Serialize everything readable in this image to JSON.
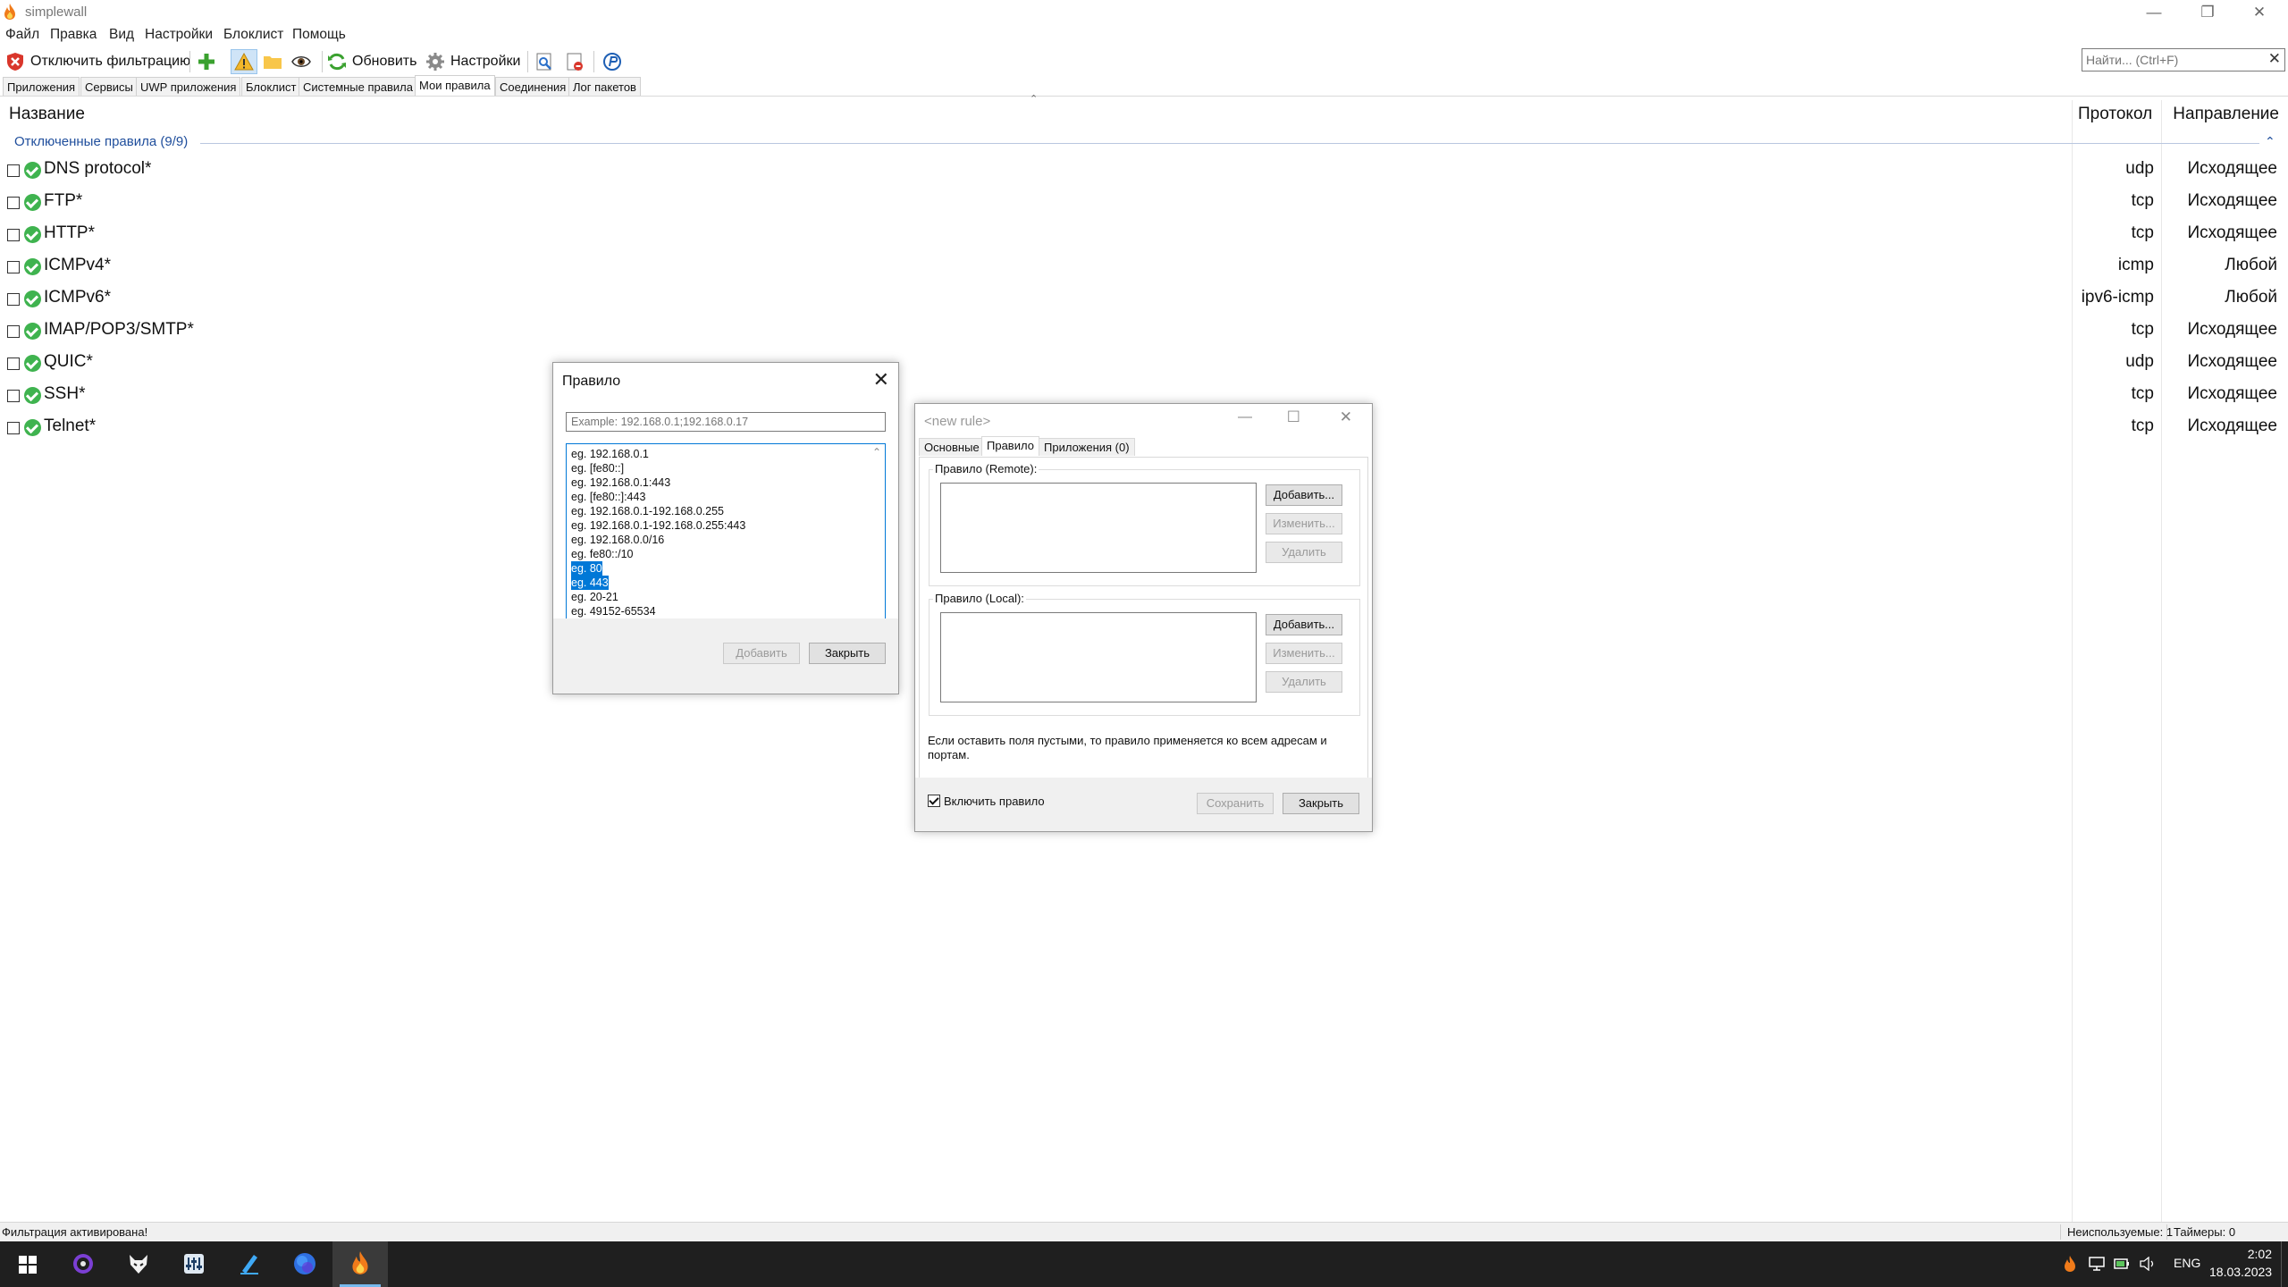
{
  "window": {
    "title": "simplewall",
    "controls": {
      "minimize": "—",
      "maximize": "❐",
      "close": "✕"
    }
  },
  "menu": [
    "Файл",
    "Правка",
    "Вид",
    "Настройки",
    "Блоклист",
    "Помощь"
  ],
  "toolbar": {
    "disable_filter_label": "Отключить фильтрацию",
    "refresh_label": "Обновить",
    "settings_label": "Настройки",
    "icons": [
      "shield-stop-icon",
      "add-icon",
      "warning-icon",
      "folder-icon",
      "eye-icon",
      "refresh-icon",
      "gear-icon",
      "log-view-icon",
      "log-clear-icon",
      "donate-icon"
    ]
  },
  "search": {
    "placeholder": "Найти... (Ctrl+F)",
    "clear": "✕"
  },
  "tabs": [
    "Приложения",
    "Сервисы",
    "UWP приложения",
    "Блоклист",
    "Системные правила",
    "Мои правила",
    "Соединения",
    "Лог пакетов"
  ],
  "active_tab": "Мои правила",
  "list": {
    "columns": {
      "name": "Название",
      "protocol": "Протокол",
      "direction": "Направление"
    },
    "group_header": "Отключенные правила (9/9)",
    "sort_arrow": "⌃",
    "group_chevron": "⌃",
    "rows": [
      {
        "name": "DNS protocol*",
        "protocol": "udp",
        "direction": "Исходящее"
      },
      {
        "name": "FTP*",
        "protocol": "tcp",
        "direction": "Исходящее"
      },
      {
        "name": "HTTP*",
        "protocol": "tcp",
        "direction": "Исходящее"
      },
      {
        "name": "ICMPv4*",
        "protocol": "icmp",
        "direction": "Любой"
      },
      {
        "name": "ICMPv6*",
        "protocol": "ipv6-icmp",
        "direction": "Любой"
      },
      {
        "name": "IMAP/POP3/SMTP*",
        "protocol": "tcp",
        "direction": "Исходящее"
      },
      {
        "name": "QUIC*",
        "protocol": "udp",
        "direction": "Исходящее"
      },
      {
        "name": "SSH*",
        "protocol": "tcp",
        "direction": "Исходящее"
      },
      {
        "name": "Telnet*",
        "protocol": "tcp",
        "direction": "Исходящее"
      }
    ]
  },
  "rule_dialog": {
    "title": "Правило",
    "close": "✕",
    "input_placeholder": "Example: 192.168.0.1;192.168.0.17",
    "examples": [
      {
        "text": "eg. 192.168.0.1",
        "selected": false
      },
      {
        "text": "eg. [fe80::]",
        "selected": false
      },
      {
        "text": "eg. 192.168.0.1:443",
        "selected": false
      },
      {
        "text": "eg. [fe80::]:443",
        "selected": false
      },
      {
        "text": "eg. 192.168.0.1-192.168.0.255",
        "selected": false
      },
      {
        "text": "eg. 192.168.0.1-192.168.0.255:443",
        "selected": false
      },
      {
        "text": "eg. 192.168.0.0/16",
        "selected": false
      },
      {
        "text": "eg. fe80::/10",
        "selected": false
      },
      {
        "text": "eg. 80",
        "selected": true
      },
      {
        "text": "eg. 443",
        "selected": true
      },
      {
        "text": "eg. 20-21",
        "selected": false
      },
      {
        "text": "eg. 49152-65534",
        "selected": false
      }
    ],
    "scroll_up": "⌃",
    "scroll_down": "⌄",
    "add_label": "Добавить",
    "close_label": "Закрыть"
  },
  "new_rule_dialog": {
    "title": "<new rule>",
    "controls": {
      "minimize": "—",
      "maximize": "☐",
      "close": "✕"
    },
    "tabs": [
      "Основные",
      "Правило",
      "Приложения (0)"
    ],
    "active_tab": "Правило",
    "remote_group": "Правило (Remote):",
    "local_group": "Правило (Local):",
    "add_btn": "Добавить...",
    "edit_btn": "Изменить...",
    "delete_btn": "Удалить",
    "note": "Если оставить поля пустыми, то правило применяется ко всем адресам и портам.",
    "enable_rule_label": "Включить правило",
    "enable_rule_checked": true,
    "save_label": "Сохранить",
    "close_label": "Закрыть"
  },
  "statusbar": {
    "left": "Фильтрация активирована!",
    "unused": "Неиспользуемые: 1",
    "timers": "Таймеры: 0"
  },
  "taskbar": {
    "apps": [
      "windows-start-icon",
      "media-app-icon",
      "fox-app-icon",
      "equalizer-app-icon",
      "pen-app-icon",
      "globe-app-icon",
      "simplewall-taskbar-icon"
    ],
    "tray_icons": [
      "flame-tray-icon",
      "network-tray-icon",
      "battery-tray-icon",
      "volume-tray-icon"
    ],
    "lang": "ENG",
    "time": "2:02",
    "date": "18.03.2023"
  },
  "colors": {
    "accent": "#0078d7",
    "group_header": "#1f4e9c",
    "ok_green": "#3fb34f",
    "taskbar_bg": "#1f1f1f"
  }
}
